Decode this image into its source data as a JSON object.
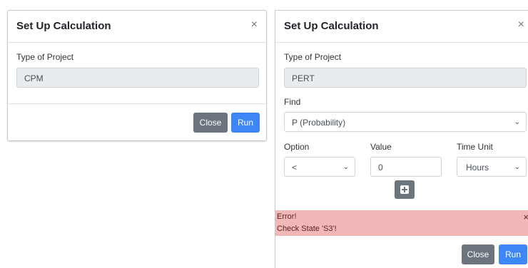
{
  "left_modal": {
    "title": "Set Up Calculation",
    "close_symbol": "×",
    "type_label": "Type of Project",
    "type_value": "CPM",
    "close_button": "Close",
    "run_button": "Run"
  },
  "right_modal": {
    "title": "Set Up Calculation",
    "close_symbol": "×",
    "type_label": "Type of Project",
    "type_value": "PERT",
    "find_label": "Find",
    "find_value": "P (Probability)",
    "option_label": "Option",
    "option_value": "<",
    "value_label": "Value",
    "value_value": "0",
    "time_unit_label": "Time Unit",
    "time_unit_value": "Hours",
    "alert": {
      "line1": "Error!",
      "line2": "Check State 'S3'!",
      "close_symbol": "×"
    },
    "close_button": "Close",
    "run_button": "Run"
  },
  "icons": {
    "chevron": "chevron-down-icon",
    "add": "plus-square-icon"
  },
  "colors": {
    "primary": "#3d86f6",
    "secondary": "#6c757d",
    "alert_bg": "#f2b8b8"
  }
}
